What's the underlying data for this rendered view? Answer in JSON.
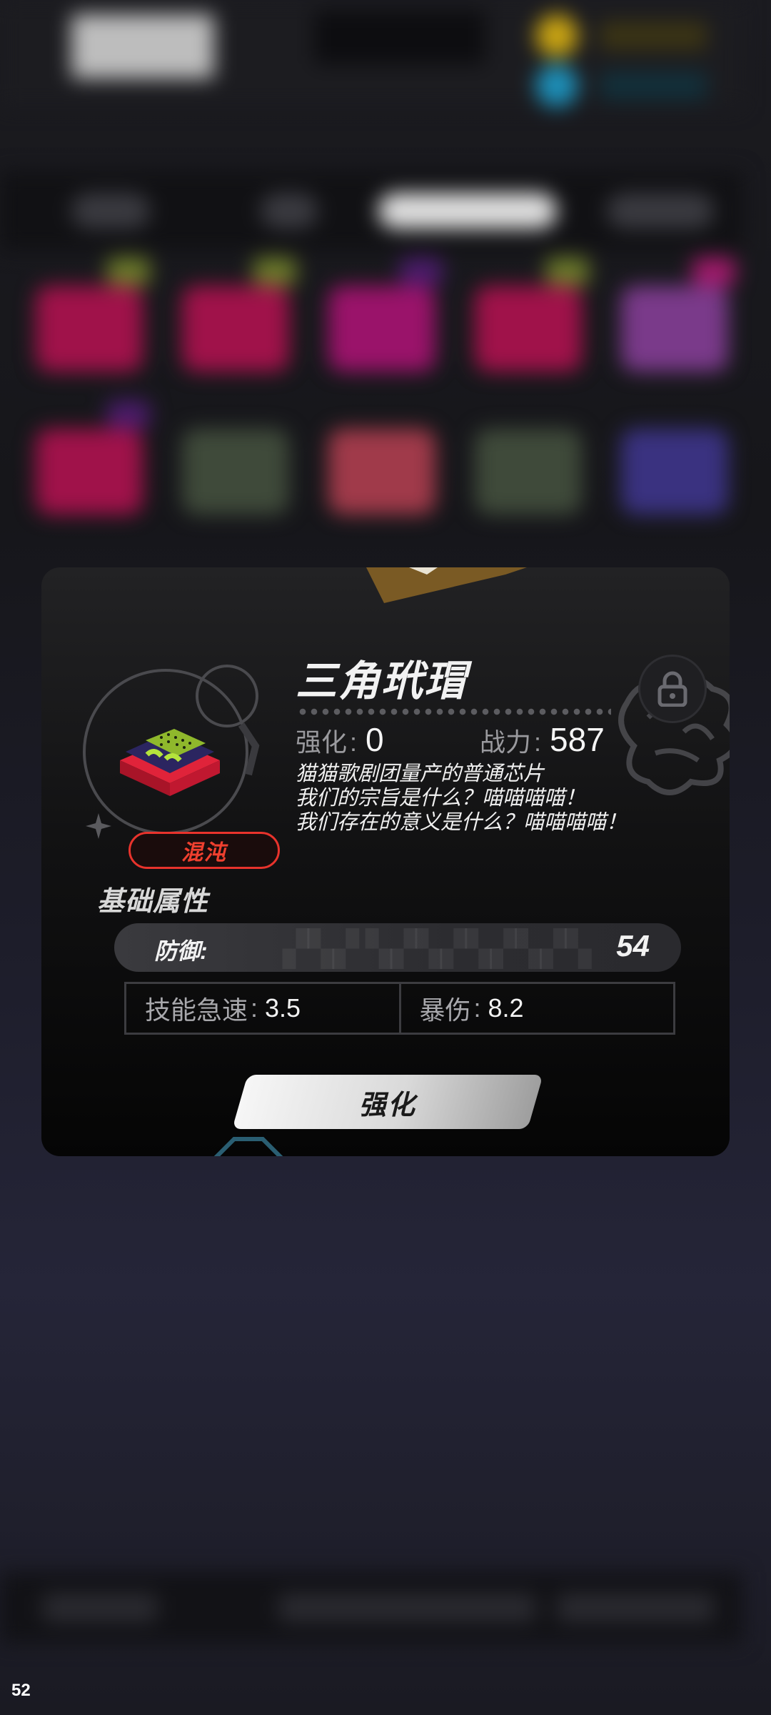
{
  "dialog": {
    "title": "三角玳瑁",
    "rarity": "混沌",
    "enhance_label": "强化",
    "enhance_colon": ":",
    "enhance_level": "0",
    "power_label": "战力",
    "power_colon": ":",
    "power_value": "587",
    "description": [
      "猫猫歌剧团量产的普通芯片",
      "我们的宗旨是什么？喵喵喵喵！",
      "我们存在的意义是什么？喵喵喵喵！"
    ],
    "section_title": "基础属性",
    "main_attribute": {
      "label": "防御:",
      "value": "54"
    },
    "sub_attributes": [
      {
        "label": "技能急速",
        "colon": ":",
        "value": "3.5"
      },
      {
        "label": "暴伤",
        "colon": ":",
        "value": "8.2"
      }
    ],
    "button_label": "强化"
  },
  "overlay": {
    "fps": "52"
  },
  "colors": {
    "rarity_red": "#e8332c",
    "dialog_bg": "#121213",
    "button_light": "#f6f6f6",
    "chip_red": "#e0233a",
    "chip_green": "#b4e33c",
    "chip_navy": "#2b2560"
  },
  "icons": {
    "lock": "lock-icon",
    "chip": "chip-item-icon",
    "sparkle": "sparkle-icon"
  }
}
